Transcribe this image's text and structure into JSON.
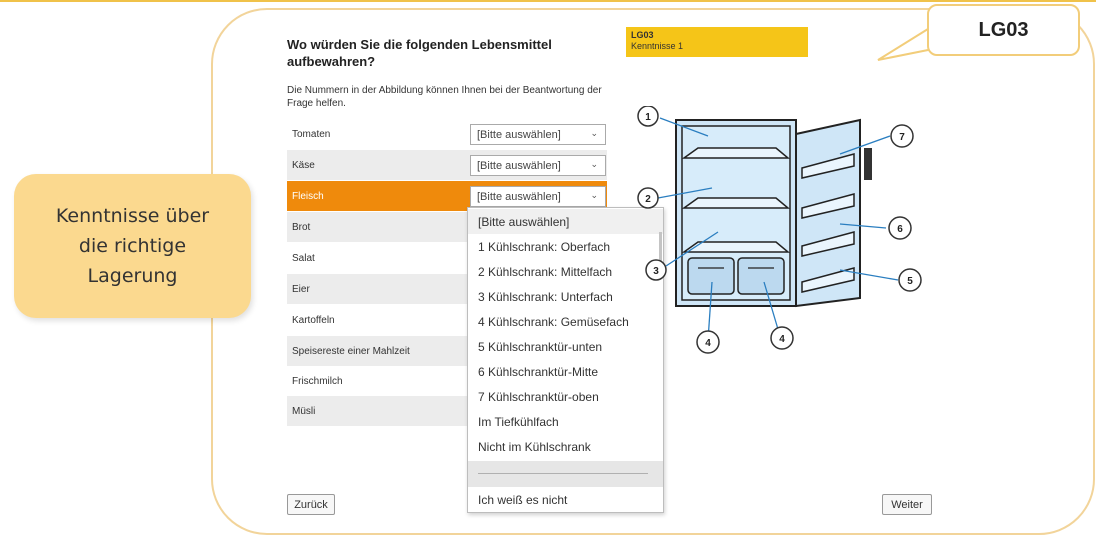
{
  "callout_left": {
    "lines": [
      "Kenntnisse über",
      "die richtige",
      "Lagerung"
    ]
  },
  "callout_right": {
    "label": "LG03"
  },
  "tag": {
    "code": "LG03",
    "label": "Kenntnisse 1"
  },
  "question": {
    "title": "Wo würden Sie die folgenden Lebensmittel aufbewahren?",
    "subtitle": "Die Nummern in der Abbildung können Ihnen bei der Beantwortung der Frage helfen."
  },
  "rows": [
    {
      "label": "Tomaten",
      "value": "[Bitte auswählen]"
    },
    {
      "label": "Käse",
      "value": "[Bitte auswählen]"
    },
    {
      "label": "Fleisch",
      "value": "[Bitte auswählen]"
    },
    {
      "label": "Brot"
    },
    {
      "label": "Salat"
    },
    {
      "label": "Eier"
    },
    {
      "label": "Kartoffeln"
    },
    {
      "label": "Speisereste einer Mahlzeit"
    },
    {
      "label": "Frischmilch"
    },
    {
      "label": "Müsli"
    }
  ],
  "dropdown": {
    "options": [
      "[Bitte auswählen]",
      "1 Kühlschrank: Oberfach",
      "2 Kühlschrank: Mittelfach",
      "3 Kühlschrank: Unterfach",
      "4 Kühlschrank: Gemüsefach",
      "5 Kühlschranktür-unten",
      "6 Kühlschranktür-Mitte",
      "7 Kühlschranktür-oben",
      "Im Tiefkühlfach",
      "Nicht im Kühlschrank"
    ],
    "last_option": "Ich weiß es nicht"
  },
  "fridge_labels": [
    "1",
    "2",
    "3",
    "4",
    "4",
    "5",
    "6",
    "7"
  ],
  "buttons": {
    "back": "Zurück",
    "next": "Weiter"
  },
  "colors": {
    "accent_orange": "#ef8a0c",
    "tag_yellow": "#f5c518",
    "callout_fill": "#fbd98f",
    "frame_border": "#f2d49a",
    "fridge_fill": "#cfe6f7"
  }
}
